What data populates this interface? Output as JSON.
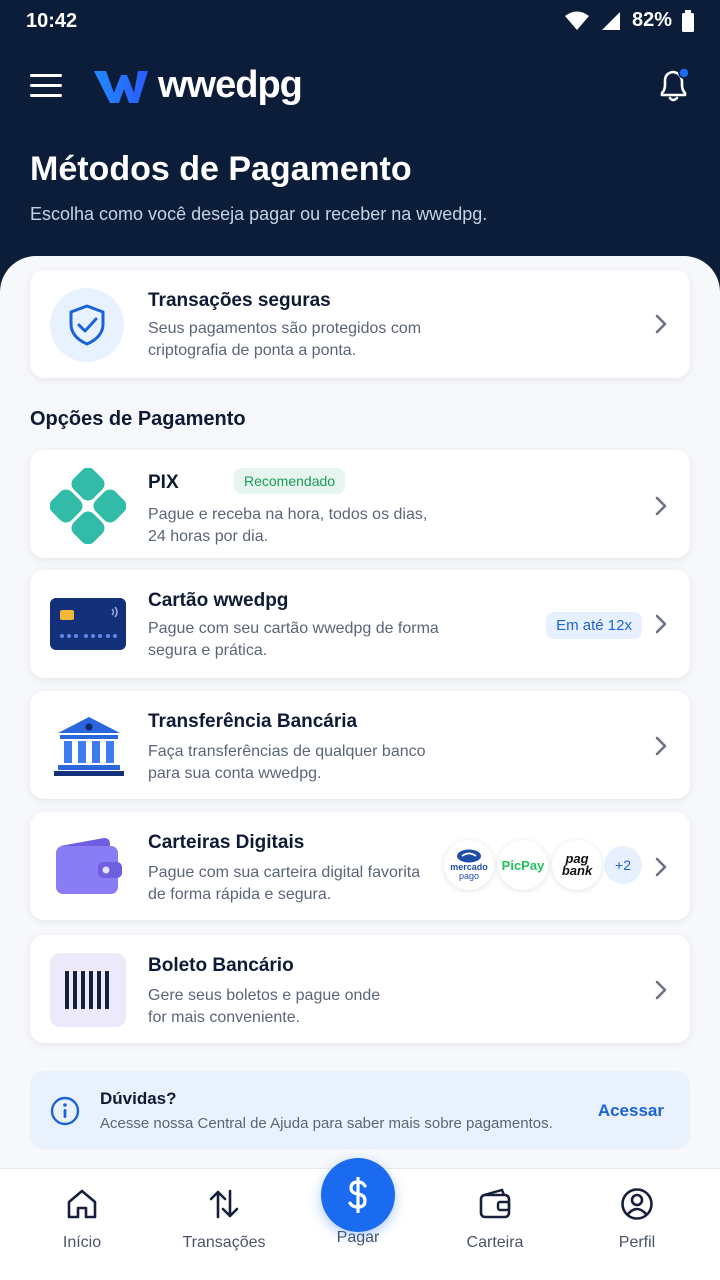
{
  "status": {
    "time": "10:42",
    "battery": "82%"
  },
  "app": {
    "name": "wwedpg"
  },
  "page": {
    "title": "Métodos de Pagamento",
    "subtitle": "Escolha como você deseja pagar ou receber na wwedpg."
  },
  "secure": {
    "title": "Transações seguras",
    "desc": "Seus pagamentos são protegidos com criptografia de ponta a ponta."
  },
  "section_title": "Opções de Pagamento",
  "methods": [
    {
      "title": "PIX",
      "badge": "Recomendado",
      "desc": "Pague e receba na hora, todos os dias, 24 horas por dia."
    },
    {
      "title": "Cartão wwedpg",
      "badge": "Em até 12x",
      "desc": "Pague com seu cartão wwedpg de forma segura e prática."
    },
    {
      "title": "Transferência Bancária",
      "desc": "Faça transferências de qualquer banco para sua conta wwedpg."
    },
    {
      "title": "Carteiras Digitais",
      "desc": "Pague com sua carteira digital favorita de forma rápida e segura.",
      "wallets": {
        "mp_line1": "mercado",
        "mp_line2": "pago",
        "picpay": "PicPay",
        "pag_line1": "pag",
        "pag_line2": "bank",
        "more": "+2"
      }
    },
    {
      "title": "Boleto Bancário",
      "desc": "Gere seus boletos e pague onde for mais conveniente."
    }
  ],
  "help": {
    "title": "Dúvidas?",
    "desc": "Acesse nossa Central de Ajuda para saber mais sobre pagamentos.",
    "action": "Acessar"
  },
  "nav": [
    {
      "label": "Início"
    },
    {
      "label": "Transações"
    },
    {
      "label": "Pagar"
    },
    {
      "label": "Carteira"
    },
    {
      "label": "Perfil"
    }
  ],
  "colors": {
    "header": "#0c1d3a",
    "accent": "#1b6bf0",
    "pix": "#32bca8"
  }
}
